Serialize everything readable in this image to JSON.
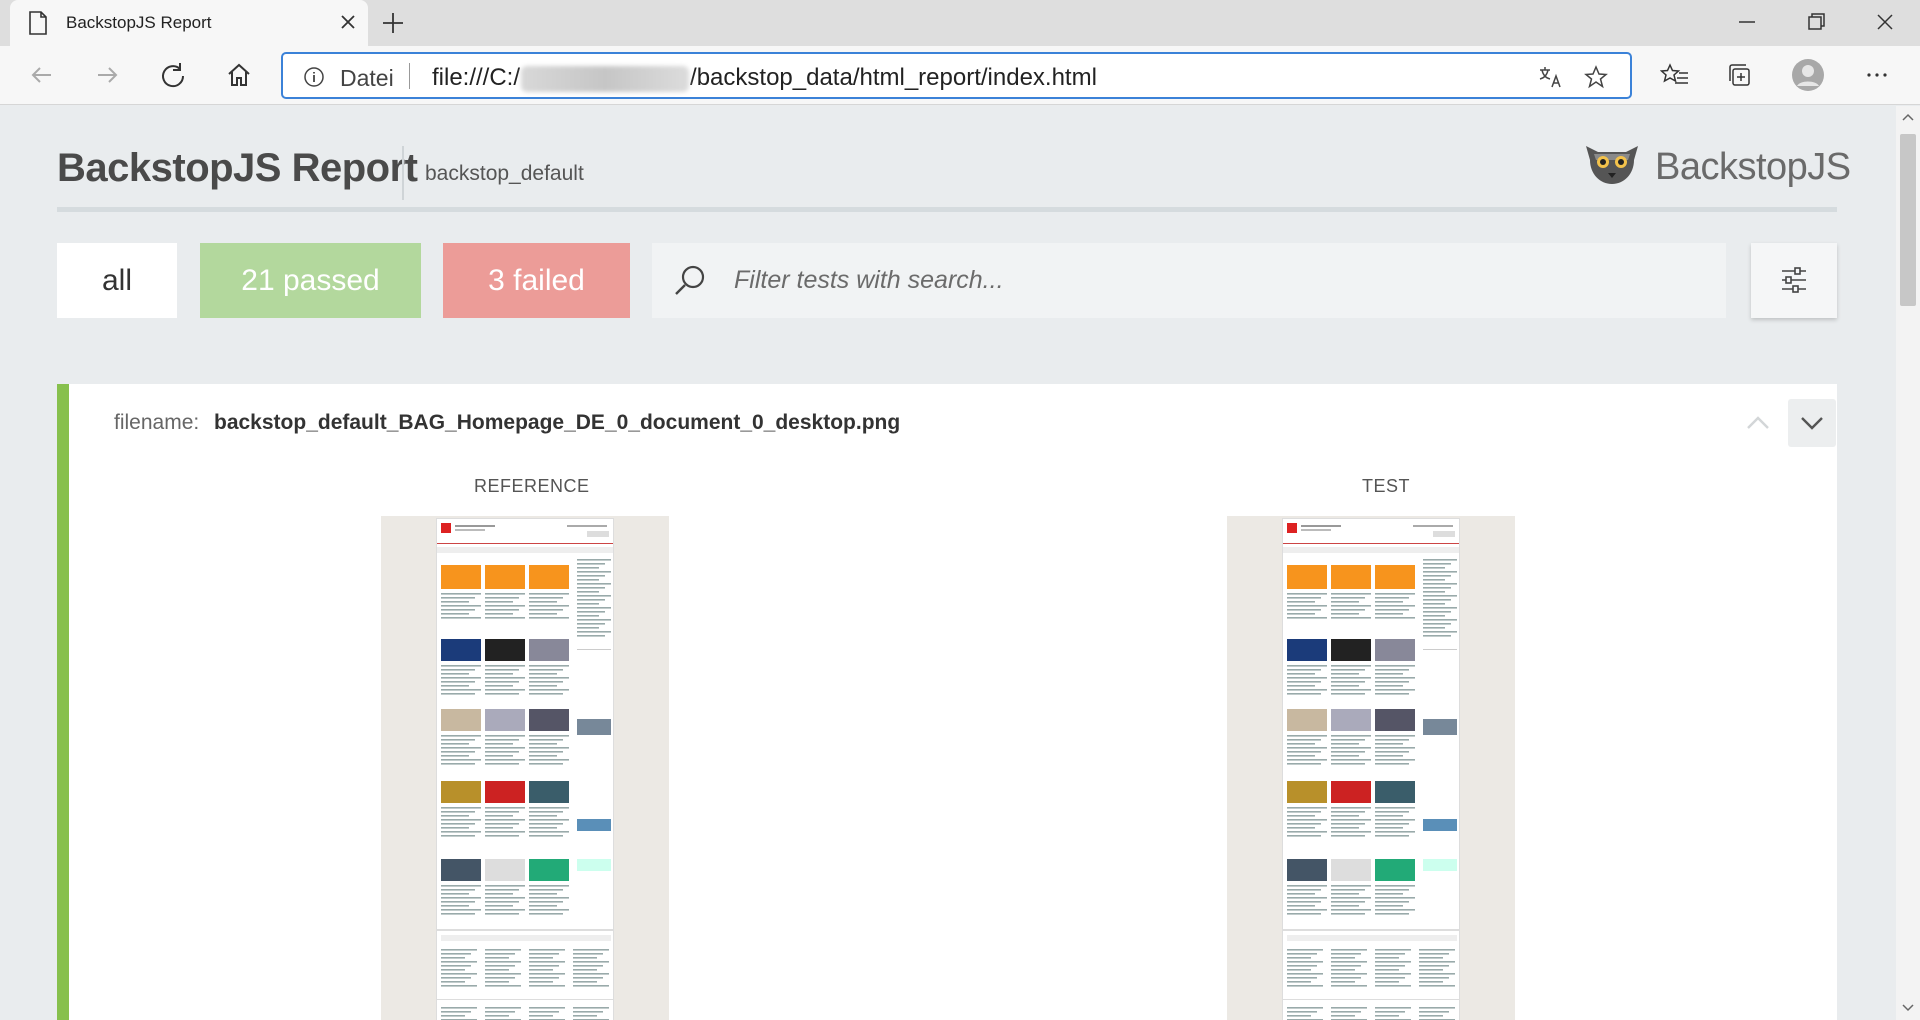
{
  "browser": {
    "tab_title": "BackstopJS Report",
    "address_prefix": "Datei",
    "url_start": "file:///C:/",
    "url_end": "/backstop_data/html_report/index.html"
  },
  "report": {
    "title": "BackstopJS Report",
    "config_name": "backstop_default",
    "logo_text": "BackstopJS"
  },
  "filters": {
    "all": "all",
    "passed": "21 passed",
    "failed": "3 failed",
    "search_placeholder": "Filter tests with search..."
  },
  "test": {
    "filename_label": "filename:",
    "filename": "backstop_default_BAG_Homepage_DE_0_document_0_desktop.png",
    "reference_label": "REFERENCE",
    "test_label": "TEST",
    "status_color": "#87c04d"
  },
  "colors": {
    "passed": "#b3d89d",
    "failed": "#ec9c98",
    "accent_orange": "#f7941d"
  }
}
